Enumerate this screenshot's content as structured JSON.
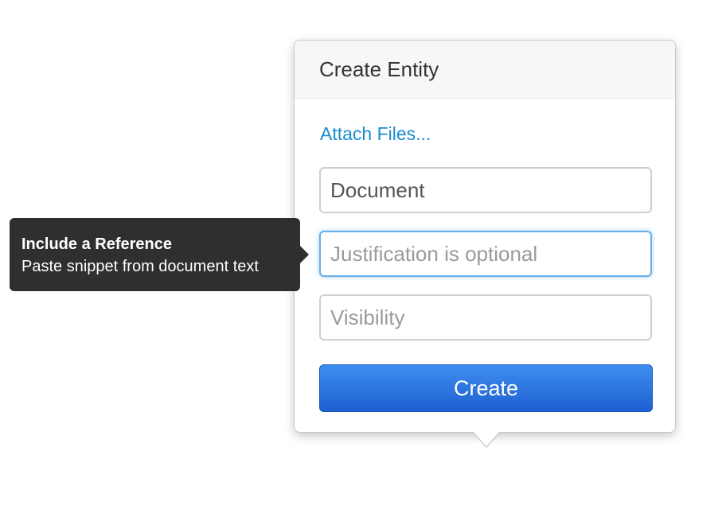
{
  "popover": {
    "title": "Create Entity",
    "attach_link": "Attach Files...",
    "fields": {
      "document": {
        "value": "Document",
        "placeholder": ""
      },
      "justification": {
        "value": "",
        "placeholder": "Justification is optional"
      },
      "visibility": {
        "value": "",
        "placeholder": "Visibility"
      }
    },
    "create_label": "Create"
  },
  "tooltip": {
    "title": "Include a Reference",
    "text": "Paste snippet from document text"
  },
  "colors": {
    "link": "#1b8ccd",
    "button_top": "#3d8ef0",
    "button_bottom": "#1e5fd0",
    "focus_ring": "#66afe9",
    "tooltip_bg": "#2f2f2f"
  }
}
